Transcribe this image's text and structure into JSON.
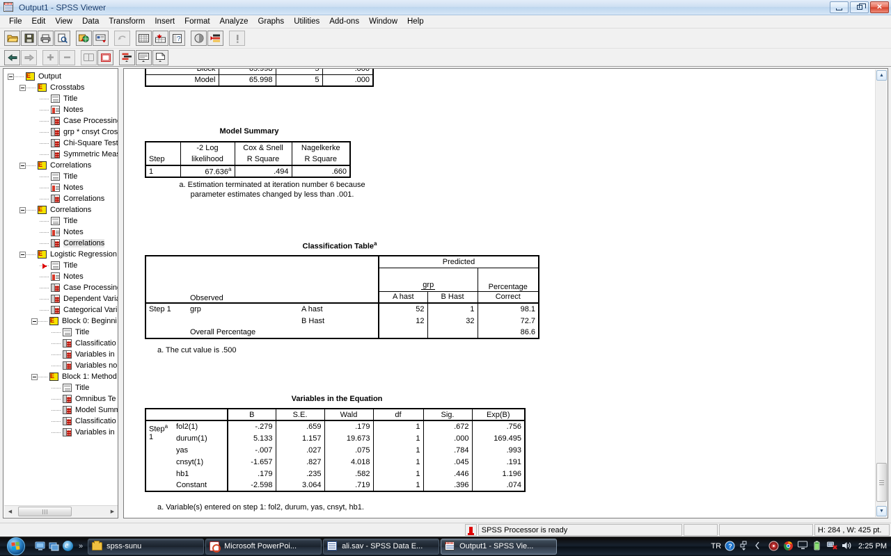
{
  "window": {
    "title": "Output1 - SPSS Viewer",
    "icon": "spss-viewer-icon",
    "buttons": {
      "minimize": "minimize",
      "restore": "restore",
      "close": "close"
    }
  },
  "menubar": {
    "items": [
      "File",
      "Edit",
      "View",
      "Data",
      "Transform",
      "Insert",
      "Format",
      "Analyze",
      "Graphs",
      "Utilities",
      "Add-ons",
      "Window",
      "Help"
    ]
  },
  "toolbar_main": {
    "buttons": [
      {
        "name": "open-file-icon",
        "glyph": "📂"
      },
      {
        "name": "save-icon",
        "glyph": "💾"
      },
      {
        "name": "print-icon",
        "glyph": "🖨"
      },
      {
        "name": "print-preview-icon",
        "glyph": "🔍"
      },
      {
        "name": "export-web-icon",
        "glyph": "🌐"
      },
      {
        "name": "recall-dialog-icon",
        "glyph": "▤"
      },
      {
        "name": "undo-icon",
        "glyph": "↶"
      },
      {
        "name": "goto-data-icon",
        "glyph": "▦"
      },
      {
        "name": "goto-case-icon",
        "glyph": "↙"
      },
      {
        "name": "variables-icon",
        "glyph": "?"
      },
      {
        "name": "find-icon",
        "glyph": "◑"
      },
      {
        "name": "insert-cases-icon",
        "glyph": "☰"
      },
      {
        "name": "run-icon",
        "glyph": "!"
      }
    ]
  },
  "toolbar_outline": {
    "buttons": [
      {
        "name": "promote-icon",
        "glyph": "⬅"
      },
      {
        "name": "demote-icon",
        "glyph": "➡"
      },
      {
        "name": "expand-icon",
        "glyph": "+"
      },
      {
        "name": "collapse-icon",
        "glyph": "−"
      },
      {
        "name": "show-icon",
        "glyph": "▭"
      },
      {
        "name": "hide-icon",
        "glyph": "⬜"
      },
      {
        "name": "insert-heading-icon",
        "glyph": "☰"
      },
      {
        "name": "insert-title-icon",
        "glyph": "☷"
      },
      {
        "name": "insert-text-icon",
        "glyph": "▤"
      }
    ]
  },
  "outline": {
    "nodes": [
      {
        "label": "Output",
        "depth": 0,
        "icon": "heading-icon",
        "expander": true
      },
      {
        "label": "Crosstabs",
        "depth": 1,
        "icon": "heading-icon",
        "expander": true
      },
      {
        "label": "Title",
        "depth": 2,
        "icon": "title-icon"
      },
      {
        "label": "Notes",
        "depth": 2,
        "icon": "notes-icon"
      },
      {
        "label": "Case Processing",
        "depth": 2,
        "icon": "table-icon"
      },
      {
        "label": "grp * cnsyt Cros",
        "depth": 2,
        "icon": "table-icon"
      },
      {
        "label": "Chi-Square Test",
        "depth": 2,
        "icon": "table-icon"
      },
      {
        "label": "Symmetric Meas",
        "depth": 2,
        "icon": "table-icon"
      },
      {
        "label": "Correlations",
        "depth": 1,
        "icon": "heading-icon",
        "expander": true
      },
      {
        "label": "Title",
        "depth": 2,
        "icon": "title-icon"
      },
      {
        "label": "Notes",
        "depth": 2,
        "icon": "notes-icon"
      },
      {
        "label": "Correlations",
        "depth": 2,
        "icon": "table-icon"
      },
      {
        "label": "Correlations",
        "depth": 1,
        "icon": "heading-icon",
        "expander": true
      },
      {
        "label": "Title",
        "depth": 2,
        "icon": "title-icon"
      },
      {
        "label": "Notes",
        "depth": 2,
        "icon": "notes-icon"
      },
      {
        "label": "Correlations",
        "depth": 2,
        "icon": "table-icon",
        "selected": true
      },
      {
        "label": "Logistic Regression",
        "depth": 1,
        "icon": "heading-icon",
        "expander": true
      },
      {
        "label": "Title",
        "depth": 2,
        "icon": "title-icon",
        "marker": true
      },
      {
        "label": "Notes",
        "depth": 2,
        "icon": "notes-icon"
      },
      {
        "label": "Case Processing",
        "depth": 2,
        "icon": "table-icon"
      },
      {
        "label": "Dependent Varia",
        "depth": 2,
        "icon": "table-icon"
      },
      {
        "label": "Categorical Vari",
        "depth": 2,
        "icon": "table-icon"
      },
      {
        "label": "Block 0: Beginni",
        "depth": 2,
        "icon": "heading-icon",
        "expander": true
      },
      {
        "label": "Title",
        "depth": 3,
        "icon": "title-icon"
      },
      {
        "label": "Classificatio",
        "depth": 3,
        "icon": "table-icon"
      },
      {
        "label": "Variables in",
        "depth": 3,
        "icon": "table-icon"
      },
      {
        "label": "Variables no",
        "depth": 3,
        "icon": "table-icon"
      },
      {
        "label": "Block 1: Method",
        "depth": 2,
        "icon": "heading-icon",
        "expander": true
      },
      {
        "label": "Title",
        "depth": 3,
        "icon": "title-icon"
      },
      {
        "label": "Omnibus Te",
        "depth": 3,
        "icon": "table-icon"
      },
      {
        "label": "Model Summ",
        "depth": 3,
        "icon": "table-icon"
      },
      {
        "label": "Classificatio",
        "depth": 3,
        "icon": "table-icon"
      },
      {
        "label": "Variables in",
        "depth": 3,
        "icon": "table-icon"
      }
    ]
  },
  "output": {
    "omnibus_partial": {
      "row_label": "Model",
      "chi_square": "65.998",
      "df": "5",
      "sig": ".000"
    },
    "model_summary": {
      "title": "Model Summary",
      "headers": [
        "Step",
        "-2 Log likelihood",
        "Cox & Snell R Square",
        "Nagelkerke R Square"
      ],
      "header_lines": [
        [
          "",
          "Step"
        ],
        [
          "-2 Log",
          "likelihood"
        ],
        [
          "Cox & Snell",
          "R Square"
        ],
        [
          "Nagelkerke",
          "R Square"
        ]
      ],
      "row": {
        "step": "1",
        "m2ll": "67.636",
        "m2ll_sup": "a",
        "cox_snell": ".494",
        "nagelkerke": ".660"
      },
      "footnote": "a. Estimation terminated at iteration number 6 because parameter estimates changed by less than .001.",
      "footnote_line1": "a. Estimation terminated at iteration number 6 because",
      "footnote_line2": "parameter estimates changed by less than .001."
    },
    "classification_table": {
      "title": "Classification Table",
      "title_sup": "a",
      "predicted_label": "Predicted",
      "grp_label": "grp",
      "observed_label": "Observed",
      "percentage_line1": "Percentage",
      "percentage_line2": "Correct",
      "col_a": "A hast",
      "col_b": "B Hast",
      "step_label": "Step 1",
      "grp_row_label": "grp",
      "rows": [
        {
          "observed": "A hast",
          "a": "52",
          "b": "1",
          "pct": "98.1"
        },
        {
          "observed": "B Hast",
          "a": "12",
          "b": "32",
          "pct": "72.7"
        }
      ],
      "overall_label": "Overall Percentage",
      "overall_pct": "86.6",
      "footnote": "a. The cut value is .500"
    },
    "variables_in_equation": {
      "title": "Variables in the Equation",
      "headers": [
        "",
        "B",
        "S.E.",
        "Wald",
        "df",
        "Sig.",
        "Exp(B)"
      ],
      "step_label": "Step",
      "step_sup": "a",
      "step_number": "1",
      "rows": [
        {
          "var": "fol2(1)",
          "B": "-.279",
          "SE": ".659",
          "Wald": ".179",
          "df": "1",
          "Sig": ".672",
          "ExpB": ".756"
        },
        {
          "var": "durum(1)",
          "B": "5.133",
          "SE": "1.157",
          "Wald": "19.673",
          "df": "1",
          "Sig": ".000",
          "ExpB": "169.495"
        },
        {
          "var": "yas",
          "B": "-.007",
          "SE": ".027",
          "Wald": ".075",
          "df": "1",
          "Sig": ".784",
          "ExpB": ".993"
        },
        {
          "var": "cnsyt(1)",
          "B": "-1.657",
          "SE": ".827",
          "Wald": "4.018",
          "df": "1",
          "Sig": ".045",
          "ExpB": ".191"
        },
        {
          "var": "hb1",
          "B": ".179",
          "SE": ".235",
          "Wald": ".582",
          "df": "1",
          "Sig": ".446",
          "ExpB": "1.196"
        },
        {
          "var": "Constant",
          "B": "-2.598",
          "SE": "3.064",
          "Wald": ".719",
          "df": "1",
          "Sig": ".396",
          "ExpB": ".074"
        }
      ],
      "footnote": "a. Variable(s) entered on step 1: fol2, durum, yas, cnsyt, hb1."
    }
  },
  "statusbar": {
    "processor_text": "SPSS Processor  is ready",
    "cell2": "",
    "cell3": "",
    "dimensions": "H: 284 , W: 425  pt."
  },
  "taskbar": {
    "start": "start-orb",
    "quicklaunch": [
      {
        "name": "show-desktop-icon"
      },
      {
        "name": "switch-windows-icon"
      },
      {
        "name": "internet-explorer-icon"
      }
    ],
    "chevron": "»",
    "tasks": [
      {
        "label": "spss-sunu",
        "icon": "folder-icon",
        "active": false
      },
      {
        "label": "Microsoft PowerPoi...",
        "icon": "powerpoint-icon",
        "active": false
      },
      {
        "label": "ali.sav - SPSS Data E...",
        "icon": "spss-data-editor-icon",
        "active": false
      },
      {
        "label": "Output1 - SPSS Vie...",
        "icon": "spss-viewer-icon",
        "active": true
      }
    ],
    "tray": {
      "language": "TR",
      "icons": [
        "help-icon",
        "network-flyout-icon",
        "chevron-left-icon",
        "security-icon",
        "chrome-icon",
        "display-icon",
        "battery-icon",
        "network-error-icon",
        "volume-icon"
      ],
      "clock": "2:25 PM"
    }
  },
  "colors": {
    "accent": "#3a5fa0",
    "title_text": "#13386b",
    "close_button": "#d3402a",
    "tree_heading_yellow": "#f5e400",
    "table_icon_red": "#d63a2a",
    "marker_red": "#d00000"
  }
}
